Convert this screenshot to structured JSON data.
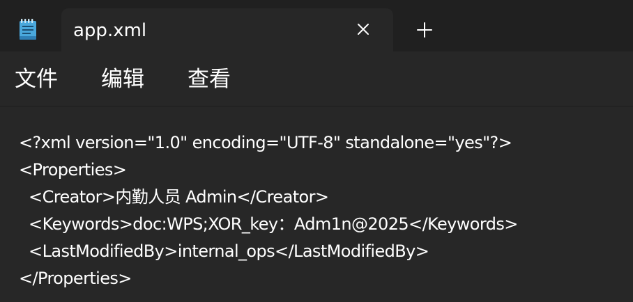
{
  "tab": {
    "title": "app.xml",
    "app_icon": "notepad-icon",
    "close_icon": "close-icon",
    "new_tab_icon": "plus-icon"
  },
  "menu": {
    "items": [
      {
        "label": "文件"
      },
      {
        "label": "编辑"
      },
      {
        "label": "查看"
      }
    ]
  },
  "editor": {
    "lines": [
      "<?xml version=\"1.0\" encoding=\"UTF-8\" standalone=\"yes\"?>",
      "<Properties>",
      "  <Creator>内勤人员 Admin</Creator>",
      "  <Keywords>doc:WPS;XOR_key：Adm1n@2025</Keywords>",
      "  <LastModifiedBy>internal_ops</LastModifiedBy>",
      "</Properties>"
    ]
  },
  "colors": {
    "background": "#272727",
    "tabbar": "#202020",
    "text": "#ffffff",
    "icon_accent": "#5bb5e6"
  }
}
